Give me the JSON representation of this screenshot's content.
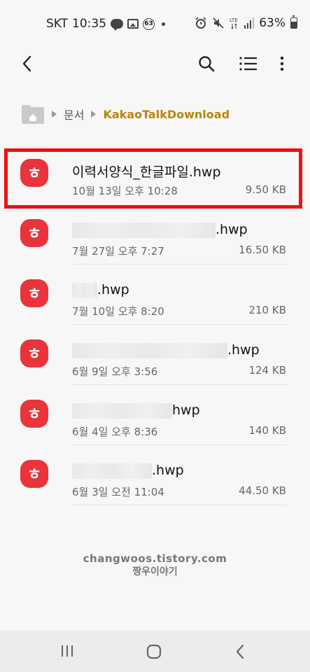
{
  "status_bar": {
    "carrier": "SKT",
    "time": "10:35",
    "notif_badge": "63",
    "battery": "63%"
  },
  "breadcrumb": {
    "folder": "문서",
    "current": "KakaoTalkDownload"
  },
  "files": [
    {
      "name_visible": "이력서양식_한글파일.hwp",
      "date": "10월 13일 오후 10:28",
      "size": "9.50 KB",
      "selected": true
    },
    {
      "name_visible": ".hwp",
      "date": "7월 27일 오후 7:27",
      "size": "16.50 KB"
    },
    {
      "name_visible": ".hwp",
      "date": "7월 10일 오후 8:20",
      "size": "210 KB"
    },
    {
      "name_visible": ".hwp",
      "date": "6월 9일 오후 3:56",
      "size": "124 KB"
    },
    {
      "name_visible": "hwp",
      "date": "6월 4일 오후 8:36",
      "size": "140 KB"
    },
    {
      "name_visible": ".hwp",
      "date": "6월 3일 오전 11:04",
      "size": "44.50 KB"
    }
  ],
  "watermark": {
    "line1": "changwoos.tistory.com",
    "line2": "짱우이야기"
  },
  "colors": {
    "hwp_icon": "#e8343a",
    "highlight": "#ee1111",
    "breadcrumb_current": "#b8860b"
  }
}
